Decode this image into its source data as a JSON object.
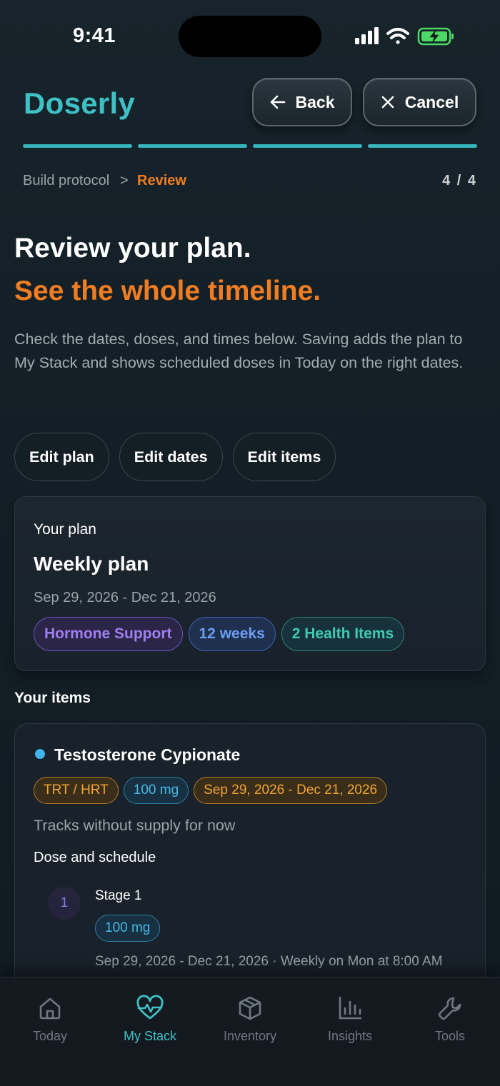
{
  "status_bar": {
    "time": "9:41"
  },
  "header": {
    "brand": "Doserly",
    "back_label": "Back",
    "cancel_label": "Cancel",
    "progress_steps_total": 4,
    "progress_steps_done": 4
  },
  "breadcrumb": {
    "parent": "Build protocol",
    "separator": ">",
    "current": "Review",
    "step_count": "4 / 4"
  },
  "hero": {
    "title": "Review your plan.",
    "subtitle": "See the whole timeline.",
    "description": "Check the dates, doses, and times below. Saving adds the plan to My Stack and shows scheduled doses in Today on the right dates."
  },
  "actions": {
    "edit_plan": "Edit plan",
    "edit_dates": "Edit dates",
    "edit_items": "Edit items"
  },
  "plan": {
    "label": "Your plan",
    "name": "Weekly plan",
    "dates": "Sep 29, 2026 - Dec 21, 2026",
    "tags": [
      "Hormone Support",
      "12 weeks",
      "2 Health Items"
    ]
  },
  "items": {
    "heading": "Your items",
    "list": [
      {
        "name": "Testosterone Cypionate",
        "chips": [
          "TRT / HRT",
          "100 mg",
          "Sep 29, 2026 - Dec 21, 2026"
        ],
        "supply_note": "Tracks without supply for now",
        "dose_heading": "Dose and schedule",
        "stages": [
          {
            "number": "1",
            "label": "Stage 1",
            "dose": "100 mg",
            "meta": "Sep 29, 2026 - Dec 21, 2026 · Weekly on Mon at 8:00 AM"
          }
        ]
      }
    ]
  },
  "tab_bar": {
    "active": "My Stack",
    "tabs": [
      {
        "label": "Today",
        "icon": "home-icon"
      },
      {
        "label": "My Stack",
        "icon": "heart-pulse-icon"
      },
      {
        "label": "Inventory",
        "icon": "box-icon"
      },
      {
        "label": "Insights",
        "icon": "bar-chart-icon"
      },
      {
        "label": "Tools",
        "icon": "wrench-icon"
      }
    ]
  },
  "colors": {
    "brand_teal": "#3fc0c5",
    "accent_orange": "#f07d22",
    "tag_purple": "#9e7ff0",
    "tag_blue": "#6a9df2",
    "tag_teal": "#3fc9b3",
    "chip_amber": "#f0a530",
    "chip_blue": "#48b8e6",
    "battery_green": "#4cd964"
  }
}
